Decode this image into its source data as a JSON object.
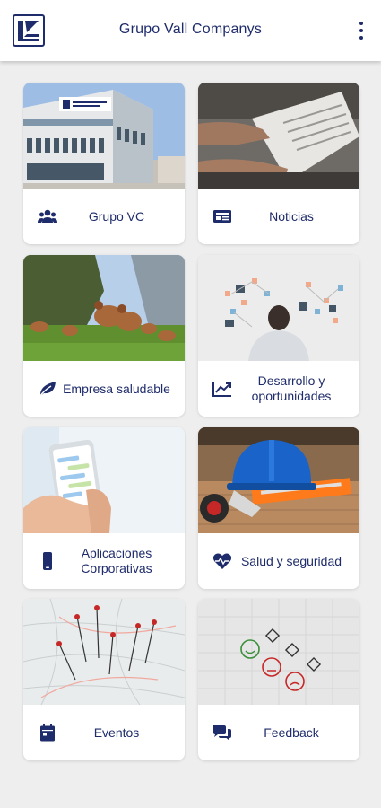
{
  "header": {
    "title": "Grupo Vall Companys",
    "logo_icon": "vc-logo-icon",
    "menu_icon": "more-vert-icon"
  },
  "colors": {
    "brand": "#1f2c6b",
    "background": "#eeeeee",
    "card": "#ffffff"
  },
  "tiles": [
    {
      "label": "Grupo VC",
      "icon": "people-icon",
      "image": "office-building-photo"
    },
    {
      "label": "Noticias",
      "icon": "newspaper-icon",
      "image": "newspaper-reading-photo"
    },
    {
      "label": "Empresa saludable",
      "icon": "leaf-icon",
      "image": "chickens-field-photo"
    },
    {
      "label": "Desarrollo y oportunidades",
      "icon": "trending-up-icon",
      "image": "planning-wall-photo"
    },
    {
      "label": "Aplicaciones Corporativas",
      "icon": "smartphone-icon",
      "image": "phone-chat-photo"
    },
    {
      "label": "Salud y seguridad",
      "icon": "heart-pulse-icon",
      "image": "safety-helmet-photo"
    },
    {
      "label": "Eventos",
      "icon": "calendar-icon",
      "image": "map-pins-photo"
    },
    {
      "label": "Feedback",
      "icon": "chat-bubbles-icon",
      "image": "feedback-faces-photo"
    }
  ]
}
